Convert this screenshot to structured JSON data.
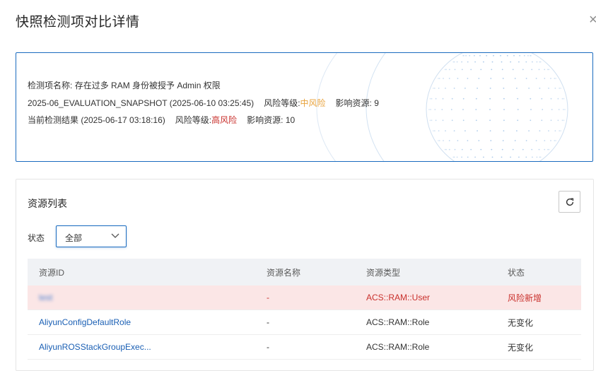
{
  "panel": {
    "title": "快照检测项对比详情",
    "close_glyph": "×"
  },
  "compare": {
    "item_label": "检测项名称:",
    "item_name": "存在过多 RAM 身份被授予 Admin 权限",
    "snapshot": {
      "name": "2025-06_EVALUATION_SNAPSHOT (2025-06-10 03:25:45)",
      "risk_label": "风险等级:",
      "risk_value": "中风险",
      "affected_label": "影响资源:",
      "affected_value": "9"
    },
    "current": {
      "name": "当前检测结果 (2025-06-17 03:18:16)",
      "risk_label": "风险等级:",
      "risk_value": "高风险",
      "affected_label": "影响资源:",
      "affected_value": "10"
    },
    "colors": {
      "mid_risk": "#e8a23b",
      "high_risk": "#c9302c",
      "accent": "#1a6bbf"
    }
  },
  "resources": {
    "title": "资源列表",
    "refresh_icon": "refresh-icon",
    "filter": {
      "label": "状态",
      "selected": "全部"
    },
    "columns": [
      "资源ID",
      "资源名称",
      "资源类型",
      "状态"
    ],
    "rows": [
      {
        "id": "test",
        "name": "-",
        "type": "ACS::RAM::User",
        "status": "风险新增",
        "highlight": true
      },
      {
        "id": "AliyunConfigDefaultRole",
        "name": "-",
        "type": "ACS::RAM::Role",
        "status": "无变化",
        "highlight": false
      },
      {
        "id": "AliyunROSStackGroupExec...",
        "name": "-",
        "type": "ACS::RAM::Role",
        "status": "无变化",
        "highlight": false
      }
    ]
  }
}
